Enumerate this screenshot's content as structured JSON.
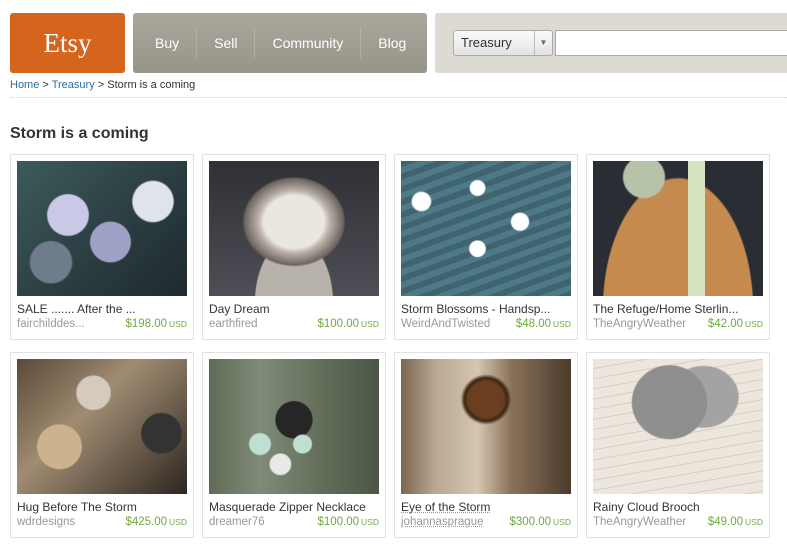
{
  "header": {
    "logo": "Etsy",
    "nav": [
      {
        "label": "Buy"
      },
      {
        "label": "Sell"
      },
      {
        "label": "Community"
      },
      {
        "label": "Blog"
      }
    ],
    "search": {
      "category": "Treasury",
      "value": "",
      "placeholder": ""
    }
  },
  "breadcrumb": {
    "home": "Home",
    "sep1": ">",
    "treasury": "Treasury",
    "sep2": ">",
    "current": "Storm is a coming"
  },
  "page_title": "Storm is a coming",
  "items": [
    {
      "title": "SALE ....... After the ...",
      "shop": "fairchilddes...",
      "price": "$198.00",
      "currency": "USD"
    },
    {
      "title": "Day Dream",
      "shop": "earthfired",
      "price": "$100.00",
      "currency": "USD"
    },
    {
      "title": "Storm Blossoms - Handsp...",
      "shop": "WeirdAndTwisted",
      "price": "$48.00",
      "currency": "USD"
    },
    {
      "title": "The Refuge/Home Sterlin...",
      "shop": "TheAngryWeather",
      "price": "$42.00",
      "currency": "USD"
    },
    {
      "title": "Hug Before The Storm",
      "shop": "wdrdesigns",
      "price": "$425.00",
      "currency": "USD"
    },
    {
      "title": "Masquerade Zipper Necklace",
      "shop": "dreamer76",
      "price": "$100.00",
      "currency": "USD"
    },
    {
      "title": "Eye of the Storm",
      "shop": "johannasprague",
      "price": "$300.00",
      "currency": "USD"
    },
    {
      "title": "Rainy Cloud Brooch",
      "shop": "TheAngryWeather",
      "price": "$49.00",
      "currency": "USD"
    }
  ],
  "colors": {
    "logo_bg": "#d5641c",
    "nav_bg": "#a19e93",
    "link": "#2a6fa3",
    "price": "#6eaa3c",
    "shop": "#999999"
  }
}
